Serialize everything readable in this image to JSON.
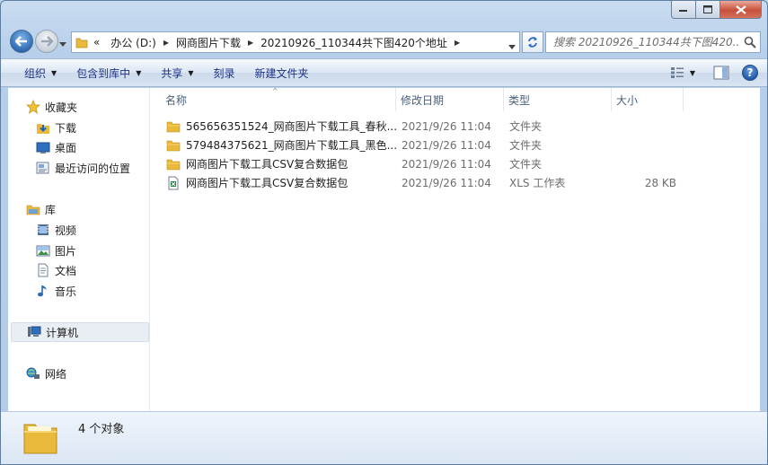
{
  "address": {
    "crumbs": [
      "«",
      "办公 (D:)",
      "网商图片下载",
      "20210926_110344共下图420个地址"
    ]
  },
  "search": {
    "placeholder": "搜索 20210926_110344共下图420..."
  },
  "toolbar": {
    "organize": "组织",
    "include_in_library": "包含到库中",
    "share": "共享",
    "burn": "刻录",
    "new_folder": "新建文件夹"
  },
  "nav": {
    "favorites": "收藏夹",
    "downloads": "下载",
    "desktop": "桌面",
    "recent": "最近访问的位置",
    "libraries": "库",
    "videos": "视频",
    "pictures": "图片",
    "documents": "文档",
    "music": "音乐",
    "computer": "计算机",
    "network": "网络"
  },
  "columns": {
    "name": "名称",
    "date": "修改日期",
    "type": "类型",
    "size": "大小"
  },
  "files": [
    {
      "name": "565656351524_网商图片下载工具_春秋...",
      "date": "2021/9/26 11:04",
      "type": "文件夹",
      "size": "",
      "icon": "folder-icon"
    },
    {
      "name": "579484375621_网商图片下载工具_黑色...",
      "date": "2021/9/26 11:04",
      "type": "文件夹",
      "size": "",
      "icon": "folder-icon"
    },
    {
      "name": "网商图片下载工具CSV复合数据包",
      "date": "2021/9/26 11:04",
      "type": "文件夹",
      "size": "",
      "icon": "folder-icon"
    },
    {
      "name": "网商图片下载工具CSV复合数据包",
      "date": "2021/9/26 11:04",
      "type": "XLS 工作表",
      "size": "28 KB",
      "icon": "excel-file-icon"
    }
  ],
  "status": {
    "count": "4 个对象"
  },
  "colors": {
    "folder": "#e8b93a",
    "accent": "#1e3287",
    "excel": "#1d7a3a"
  }
}
